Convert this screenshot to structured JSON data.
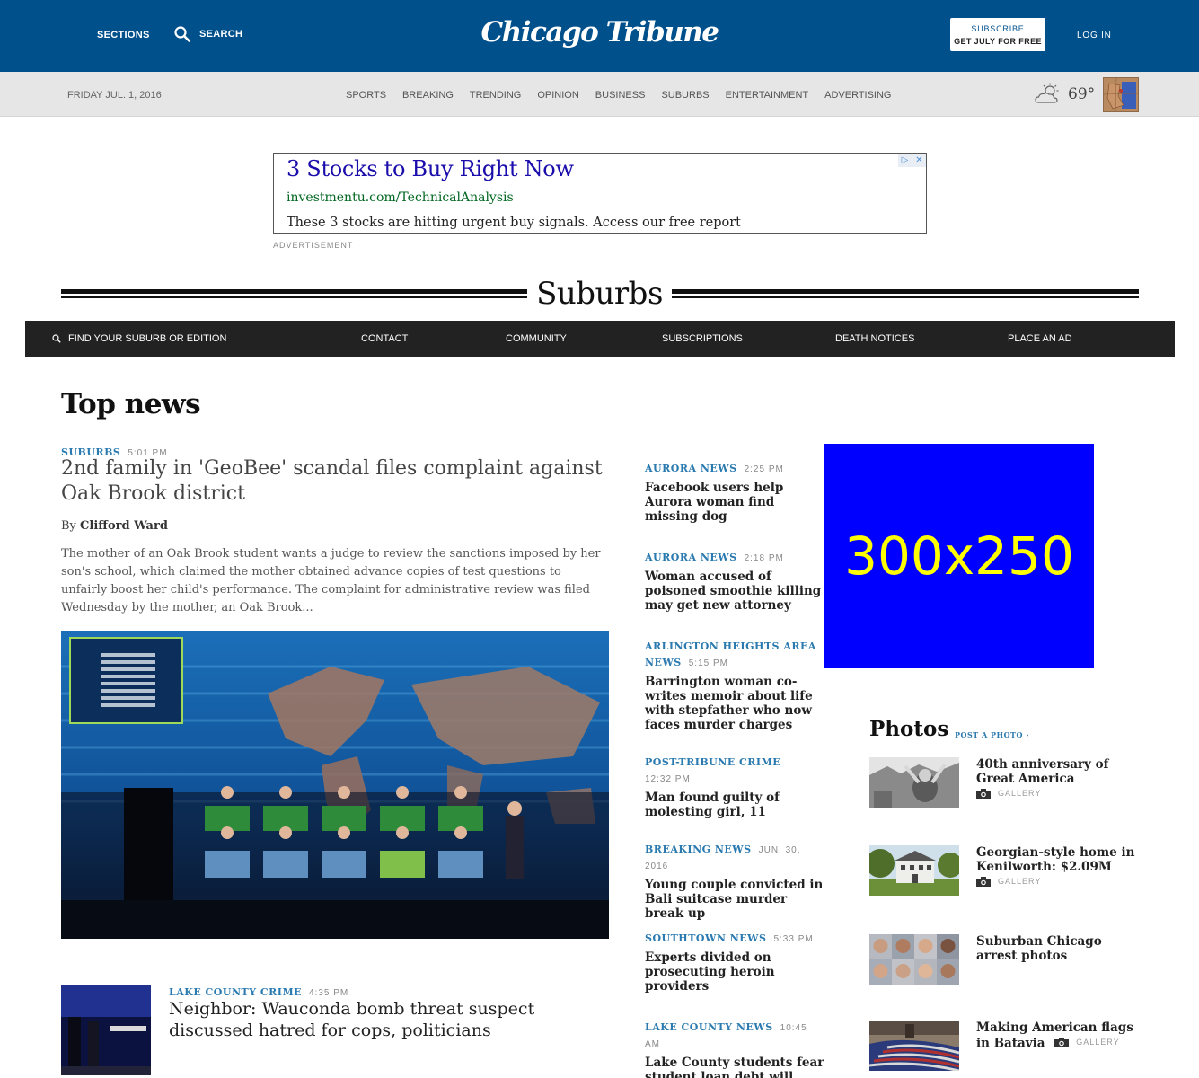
{
  "topbar": {
    "sections_label": "SECTIONS",
    "search_label": "SEARCH",
    "logo": "Chicago Tribune",
    "subscribe_label": "SUBSCRIBE",
    "subscribe_offer": "GET JULY FOR FREE",
    "login_label": "LOG IN"
  },
  "subbar": {
    "date": "FRIDAY JUL. 1, 2016",
    "nav": [
      "SPORTS",
      "BREAKING",
      "TRENDING",
      "OPINION",
      "BUSINESS",
      "SUBURBS",
      "ENTERTAINMENT",
      "ADVERTISING"
    ],
    "temperature": "69°",
    "weather_icon": "partly-cloudy-icon"
  },
  "ad": {
    "title": "3 Stocks to Buy Right Now",
    "url": "investmentu.com/TechnicalAnalysis",
    "text": "These 3 stocks are hitting urgent buy signals. Access our free report",
    "label": "ADVERTISEMENT"
  },
  "section": {
    "title": "Suburbs",
    "find_label": "FIND YOUR SUBURB OR EDITION",
    "nav": [
      "CONTACT",
      "COMMUNITY",
      "SUBSCRIPTIONS",
      "DEATH NOTICES",
      "PLACE AN AD"
    ]
  },
  "top_news": {
    "heading": "Top news",
    "lead": {
      "kicker": "SUBURBS",
      "time": "5:01 PM",
      "headline": "2nd family in 'GeoBee' scandal files complaint against Oak Brook district",
      "by": "By",
      "author": "Clifford Ward",
      "summary": "The mother of an Oak Brook student wants a judge to review the sanctions imposed by her son's school, which claimed the mother obtained advance copies of test questions to unfairly boost her child's performance. The complaint for administrative review was filed Wednesday by the mother, an Oak Brook..."
    },
    "second": {
      "kicker": "LAKE COUNTY CRIME",
      "time": "4:35 PM",
      "headline": "Neighbor: Wauconda bomb threat suspect discussed hatred for cops, politicians"
    },
    "column": [
      {
        "kicker": "AURORA NEWS",
        "time": "2:25 PM",
        "headline": "Facebook users help Aurora woman find missing dog"
      },
      {
        "kicker": "AURORA NEWS",
        "time": "2:18 PM",
        "headline": "Woman accused of poisoned smoothie killing may get new attorney"
      },
      {
        "kicker": "ARLINGTON HEIGHTS AREA NEWS",
        "time": "5:15 PM",
        "headline": "Barrington woman co-writes memoir about life with stepfather who now faces murder charges"
      },
      {
        "kicker": "POST-TRIBUNE CRIME",
        "time": "12:32 PM",
        "headline": "Man found guilty of molesting girl, 11"
      },
      {
        "kicker": "BREAKING NEWS",
        "time": "JUN. 30, 2016",
        "headline": "Young couple convicted in Bali suitcase murder break up"
      },
      {
        "kicker": "SOUTHTOWN NEWS",
        "time": "5:33 PM",
        "headline": "Experts divided on prosecuting heroin providers"
      },
      {
        "kicker": "LAKE COUNTY NEWS",
        "time": "10:45 AM",
        "headline": "Lake County students fear student loan debt will prevent big purchases"
      }
    ]
  },
  "box_ad": {
    "label": "300x250"
  },
  "photos": {
    "heading": "Photos",
    "post_label": "POST A PHOTO ›",
    "gallery_label": "GALLERY",
    "items": [
      {
        "title": "40th anniversary of Great America",
        "gallery": true
      },
      {
        "title": "Georgian-style home in Kenilworth: $2.09M",
        "gallery": true
      },
      {
        "title": "Suburban Chicago arrest photos",
        "gallery": false
      },
      {
        "title": "Making American flags in Batavia",
        "gallery": true
      }
    ]
  },
  "colors": {
    "brand_blue": "#00508c",
    "kicker_blue": "#2a7ab0",
    "ad_box_bg": "#0000ff",
    "ad_box_text": "#ffff00"
  }
}
